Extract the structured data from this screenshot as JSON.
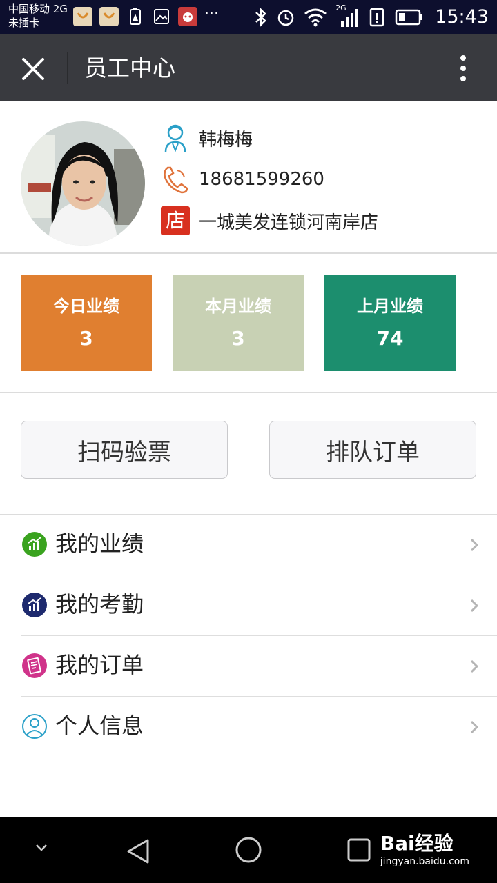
{
  "status_bar": {
    "carrier_line1": "中国移动 2G",
    "carrier_line2": "未插卡",
    "network_badge": "2G",
    "time": "15:43",
    "overflow": "···"
  },
  "header": {
    "title": "员工中心"
  },
  "profile": {
    "name": "韩梅梅",
    "phone": "18681599260",
    "store_badge": "店",
    "store": "一城美发连锁河南岸店"
  },
  "stats": [
    {
      "label": "今日业绩",
      "value": "3",
      "color": "#e07f30"
    },
    {
      "label": "本月业绩",
      "value": "3",
      "color": "#c8d1b4"
    },
    {
      "label": "上月业绩",
      "value": "74",
      "color": "#1c8e6e"
    }
  ],
  "actions": {
    "scan_label": "扫码验票",
    "queue_label": "排队订单"
  },
  "menu": [
    {
      "label": "我的业绩",
      "icon": "performance-chart-icon",
      "color": "#3aa31f"
    },
    {
      "label": "我的考勤",
      "icon": "attendance-chart-icon",
      "color": "#1e2a6e"
    },
    {
      "label": "我的订单",
      "icon": "order-list-icon",
      "color": "#d0338a"
    },
    {
      "label": "个人信息",
      "icon": "person-icon",
      "color": "#2aa0c8"
    }
  ],
  "watermark": {
    "brand": "Bai经验",
    "url": "jingyan.baidu.com"
  }
}
